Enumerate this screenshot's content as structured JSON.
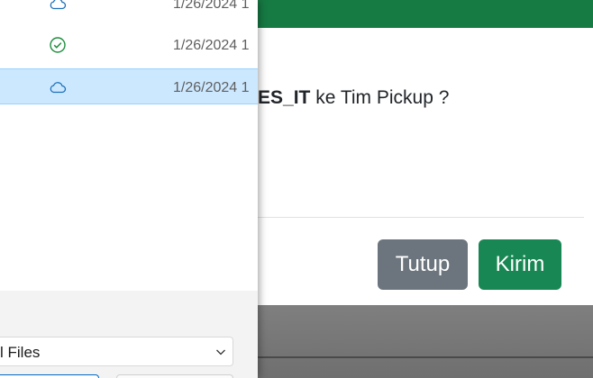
{
  "modal": {
    "message_bold": "ES_IT",
    "message_rest": " ke Tim Pickup ?",
    "close_label": "Tutup",
    "send_label": "Kirim",
    "header_color": "#167a43"
  },
  "file_dialog": {
    "rows": [
      {
        "status_icon": "cloud-icon",
        "date": "1/26/2024 1"
      },
      {
        "status_icon": "check-circle-icon",
        "date": "1/26/2024 1"
      },
      {
        "status_icon": "cloud-icon",
        "date": "1/26/2024 1",
        "selected": true
      }
    ],
    "file_type_label": "l Files",
    "selected_row_color": "#cce8ff"
  }
}
